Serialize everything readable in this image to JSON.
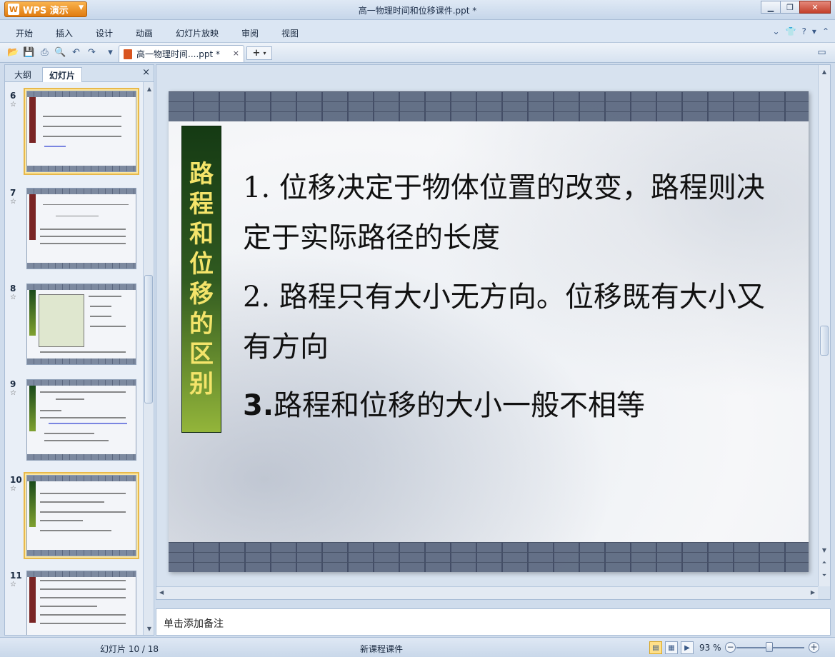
{
  "app": {
    "menu_button_label": "WPS 演示",
    "logo_glyph": "W",
    "window_title": "高一物理时间和位移课件.ppt *"
  },
  "menu": {
    "items": [
      "开始",
      "插入",
      "设计",
      "动画",
      "幻灯片放映",
      "审阅",
      "视图"
    ]
  },
  "document_tab": {
    "label": "高一物理时间....ppt *",
    "close": "×",
    "new_tab": "+"
  },
  "left_panel": {
    "tabs": [
      "大纲",
      "幻灯片"
    ],
    "active_tab": "幻灯片",
    "close": "×",
    "thumbnails": [
      {
        "number": "6",
        "star": "☆"
      },
      {
        "number": "7",
        "star": "☆"
      },
      {
        "number": "8",
        "star": "☆"
      },
      {
        "number": "9",
        "star": "☆"
      },
      {
        "number": "10",
        "star": "☆"
      },
      {
        "number": "11",
        "star": "☆"
      }
    ],
    "selected_slide": "10"
  },
  "slide": {
    "vertical_title_chars": [
      "路",
      "程",
      "和",
      "位",
      "移",
      "的",
      "区",
      "别"
    ],
    "paragraphs": [
      "1. 位移决定于物体位置的改变，路程则决定于实际路径的长度",
      "2. 路程只有大小无方向。位移既有大小又有方向"
    ],
    "paragraph3_number": "3.",
    "paragraph3_text": "路程和位移的大小一般不相等"
  },
  "notes": {
    "placeholder": "单击添加备注"
  },
  "status": {
    "slide_indicator": "幻灯片 10 / 18",
    "template_name": "新课程课件",
    "zoom": "93 %",
    "zoom_minus": "−",
    "zoom_plus": "+"
  },
  "colors": {
    "title_bar": "#c6d6ea",
    "app_button": "#e07b10",
    "slide_title_gradient_top": "#153a14",
    "slide_title_gradient_bottom": "#93b53a",
    "slide_title_text": "#f4e46a",
    "selected_thumb": "#fbe7a3"
  }
}
